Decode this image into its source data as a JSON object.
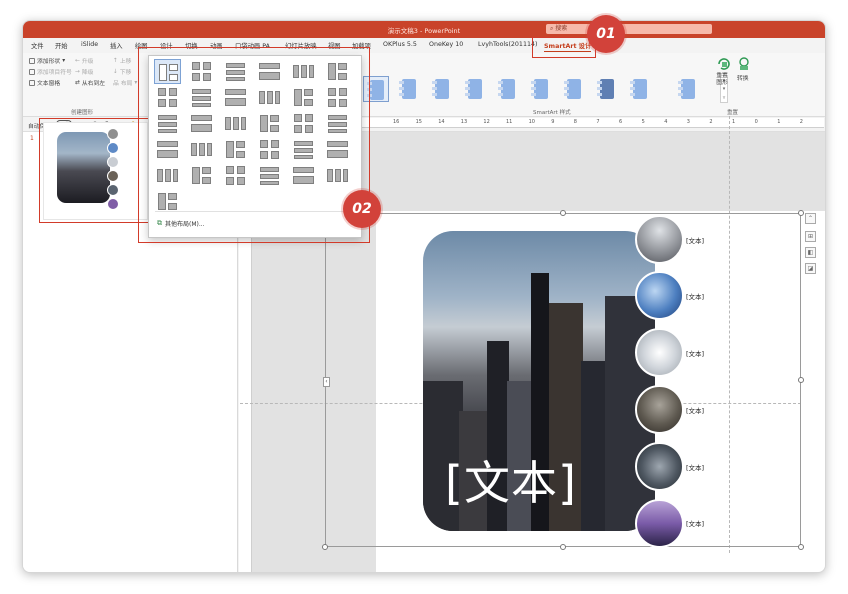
{
  "window": {
    "title": "演示文稿3 - PowerPoint",
    "search_placeholder": "搜索"
  },
  "tabs": [
    {
      "label": "文件"
    },
    {
      "label": "开始"
    },
    {
      "label": "iSlide"
    },
    {
      "label": "插入"
    },
    {
      "label": "绘图"
    },
    {
      "label": "设计"
    },
    {
      "label": "切换"
    },
    {
      "label": "动画"
    },
    {
      "label": "口袋动画 PA"
    },
    {
      "label": "幻灯片放映"
    },
    {
      "label": "视图"
    },
    {
      "label": "加载项"
    },
    {
      "label": "OKPlus 5.5"
    },
    {
      "label": "OneKey 10"
    },
    {
      "label": "LvyhTools(201114)"
    },
    {
      "label": "SmartArt 设计"
    }
  ],
  "ribbon": {
    "create": {
      "add_shape": "添加形状",
      "add_bullet": "添加项目符号",
      "text_pane": "文本窗格",
      "promote": "升级",
      "demote": "降级",
      "right_to_left": "从右到左",
      "move_up": "上移",
      "move_down": "下移",
      "layout": "布局",
      "group_label": "创建图形"
    },
    "styles_group_label": "SmartArt 样式",
    "reset": {
      "reset_graphic": "重置图形",
      "convert": "转换",
      "group_label": "重置"
    }
  },
  "qat": {
    "autosave_label": "自动保存",
    "autosave_state": "关"
  },
  "ruler_numbers": [
    "16",
    "15",
    "14",
    "13",
    "12",
    "11",
    "10",
    "9",
    "8",
    "7",
    "6",
    "5",
    "4",
    "3",
    "2",
    "1",
    "0",
    "1",
    "2"
  ],
  "slide_panel": {
    "slide_number": "1"
  },
  "layout_popup": {
    "more_layouts": "其他布局(M)..."
  },
  "smartart": {
    "main_text": "[文本]",
    "items": [
      {
        "label": "[文本]"
      },
      {
        "label": "[文本]"
      },
      {
        "label": "[文本]"
      },
      {
        "label": "[文本]"
      },
      {
        "label": "[文本]"
      },
      {
        "label": "[文本]"
      }
    ]
  },
  "badges": {
    "step1": "01",
    "step2": "02"
  },
  "colors": {
    "accent": "#c43e1c",
    "titlebar": "#c9432a",
    "highlight_box": "#d23b2a",
    "badge": "#d2423a"
  }
}
